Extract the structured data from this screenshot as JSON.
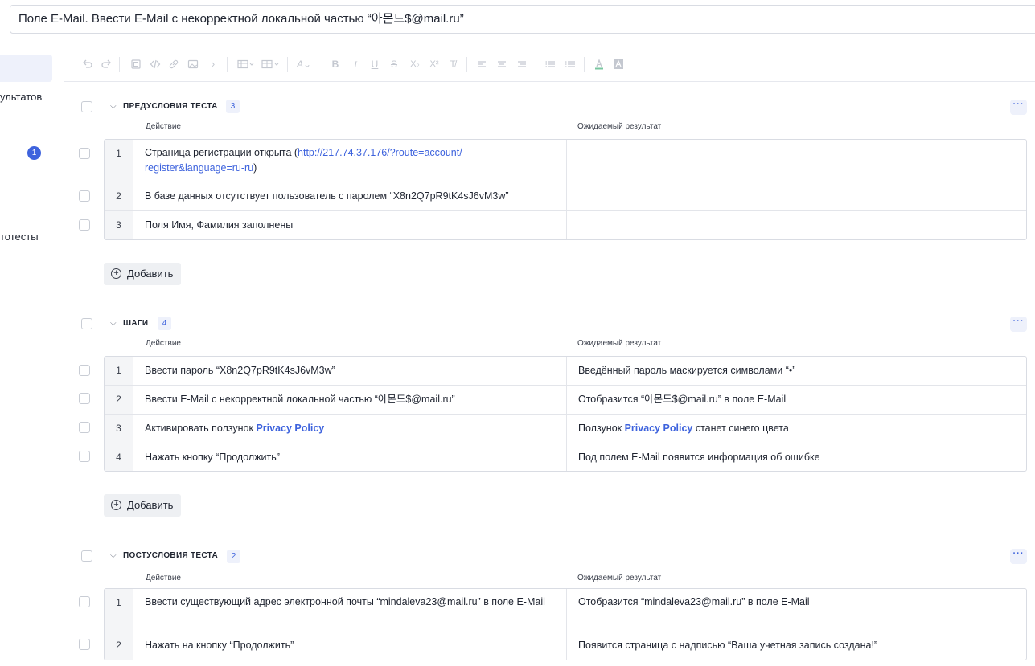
{
  "title": {
    "value": "Поле E-Mail. Ввести E-Mail с некорректной локальной частью “아몬드$@mail.ru”"
  },
  "sidebar": {
    "item_results": "ультатов",
    "badge": "1",
    "item_autotests": "тотесты"
  },
  "toolbar": {
    "icons": [
      "undo-icon",
      "redo-icon",
      "image-icon",
      "code-icon",
      "link-icon",
      "picture-icon",
      "chevron-right-icon",
      "table-icon",
      "table-edit-icon",
      "text-style-icon",
      "bold-icon",
      "italic-icon",
      "underline-icon",
      "strikethrough-icon",
      "subscript-icon",
      "superscript-icon",
      "clear-format-icon",
      "align-left-icon",
      "align-center-icon",
      "align-right-icon",
      "ordered-list-icon",
      "bullet-list-icon",
      "text-color-icon",
      "highlight-icon"
    ],
    "glyphs": {
      "B": "B",
      "I": "I",
      "U": "U",
      "S": "S",
      "sub": "X₂",
      "sup": "X²",
      "clear": "T̸",
      "style": "A"
    }
  },
  "columns": {
    "action": "Действие",
    "expected": "Ожидаемый результат"
  },
  "add_label": "Добавить",
  "more_label": "···",
  "preconditions": {
    "title": "ПРЕДУСЛОВИЯ ТЕСТА",
    "count": "3",
    "rows": [
      {
        "num": "1",
        "action_prefix": "Страница регистрации открыта (",
        "action_link": "http://217.74.37.176/?route=account/ register&language=ru-ru",
        "action_suffix": ")",
        "expected": ""
      },
      {
        "num": "2",
        "action": "В базе данных отсутствует пользователь с паролем “X8n2Q7pR9tK4sJ6vM3w”",
        "expected": ""
      },
      {
        "num": "3",
        "action": "Поля Имя, Фамилия заполнены",
        "expected": ""
      }
    ]
  },
  "steps": {
    "title": "ШАГИ",
    "count": "4",
    "rows": [
      {
        "num": "1",
        "action": "Ввести пароль “X8n2Q7pR9tK4sJ6vM3w”",
        "expected": "Введённый пароль маскируется символами “•”"
      },
      {
        "num": "2",
        "action": "Ввести E-Mail с некорректной локальной частью “아몬드$@mail.ru”",
        "expected": "Отобразится “아몬드$@mail.ru” в поле E-Mail"
      },
      {
        "num": "3",
        "action_prefix": "Активировать ползунок ",
        "action_link": "Privacy Policy",
        "expected_prefix": "Ползунок ",
        "expected_link": "Privacy Policy",
        "expected_suffix": " станет синего цвета"
      },
      {
        "num": "4",
        "action": "Нажать кнопку “Продолжить”",
        "expected": "Под полем E-Mail появится информация об ошибке"
      }
    ]
  },
  "postconditions": {
    "title": "ПОСТУСЛОВИЯ ТЕСТА",
    "count": "2",
    "rows": [
      {
        "num": "1",
        "action": "Ввести существующий адрес электронной почты “mindaleva23@mail.ru” в поле E-Mail",
        "expected": "Отобразится “mindaleva23@mail.ru” в поле E-Mail"
      },
      {
        "num": "2",
        "action": "Нажать на кнопку “Продолжить”",
        "expected": "Появится страница с надписью “Ваша учетная запись создана!”"
      }
    ]
  },
  "colors": {
    "accent": "#3e63dd",
    "badge_bg": "#eef1fb",
    "number_cell_bg": "#f4f5f7"
  }
}
